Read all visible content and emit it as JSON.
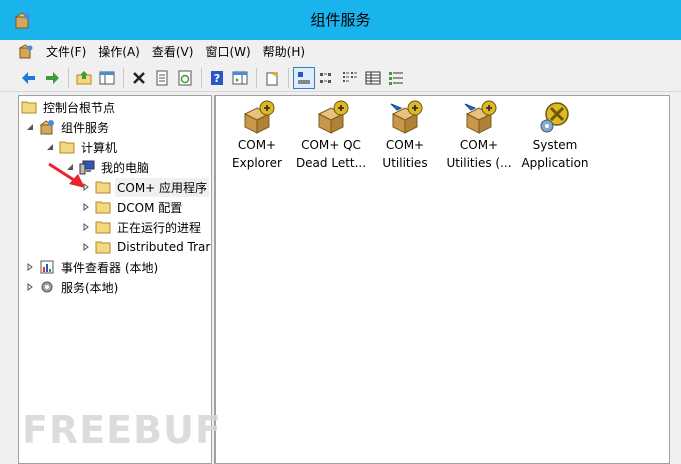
{
  "window": {
    "title": "组件服务"
  },
  "menu": {
    "items": [
      "文件(F)",
      "操作(A)",
      "查看(V)",
      "窗口(W)",
      "帮助(H)"
    ]
  },
  "toolbar": {
    "buttons": [
      "back-icon",
      "forward-icon",
      "up-folder-icon",
      "show-hide-tree-icon",
      "delete-icon",
      "properties-icon",
      "refresh-icon",
      "help-icon",
      "action-pane-icon",
      "new-icon",
      "large-icons-view-icon",
      "small-icons-view-icon",
      "list-view-icon",
      "detail-view-icon",
      "status-view-icon"
    ]
  },
  "tree": {
    "root": "控制台根节点",
    "component_services": "组件服务",
    "computers": "计算机",
    "my_computer": "我的电脑",
    "com_apps": "COM+ 应用程序",
    "dcom_config": "DCOM 配置",
    "running_processes": "正在运行的进程",
    "distributed": "Distributed Trar",
    "event_viewer": "事件查看器 (本地)",
    "services": "服务(本地)"
  },
  "content": {
    "items": [
      {
        "line1": "COM+",
        "line2": "Explorer"
      },
      {
        "line1": "COM+ QC",
        "line2": "Dead Lett..."
      },
      {
        "line1": "COM+",
        "line2": "Utilities"
      },
      {
        "line1": "COM+",
        "line2": "Utilities (..."
      },
      {
        "line1": "System",
        "line2": "Application"
      }
    ]
  },
  "watermark": {
    "text": "FREEBUF"
  },
  "colors": {
    "titlebar": "#19b4eb",
    "annotation_arrow": "#e8242f",
    "folder": "#f5d77e"
  }
}
